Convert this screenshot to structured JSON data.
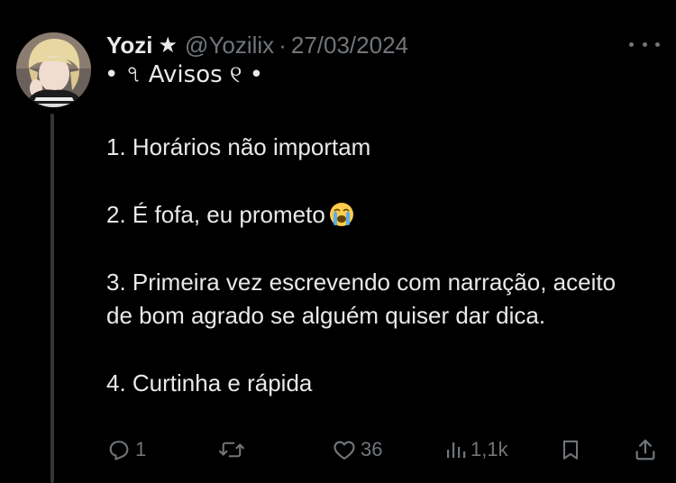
{
  "tweet": {
    "author": {
      "display_name": "Yozi",
      "badge_glyph": "★",
      "handle": "@Yozilix",
      "separator": "·",
      "date": "27/03/2024",
      "bio": "• ৭ Avisos ୧ •"
    },
    "body": [
      "1. Horários não importam",
      "2. É fofa, eu prometo",
      "3. Primeira vez escrevendo com narração, aceito de bom agrado se alguém quiser dar dica.",
      "4. Curtinha e rápida"
    ],
    "emoji": "loudly-crying-face",
    "actions": {
      "reply_count": "1",
      "retweet_count": "",
      "like_count": "36",
      "views_count": "1,1k"
    }
  },
  "colors": {
    "background": "#000000",
    "text": "#e7e9ea",
    "muted": "#71767b",
    "thread_line": "#333639"
  },
  "icons": [
    "more-icon",
    "reply-icon",
    "retweet-icon",
    "like-icon",
    "views-icon",
    "bookmark-icon",
    "share-icon"
  ]
}
